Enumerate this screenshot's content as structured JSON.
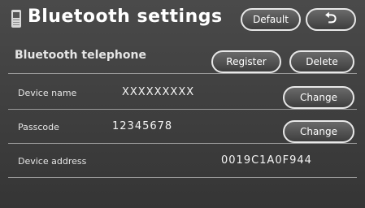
{
  "header": {
    "title": "Bluetooth settings",
    "default_label": "Default",
    "back_label": "⮌"
  },
  "bluetooth_telephone": {
    "label": "Bluetooth telephone",
    "register_label": "Register",
    "delete_label": "Delete"
  },
  "device_name": {
    "label": "Device name",
    "value": "XXXXXXXXX",
    "change_label": "Change"
  },
  "passcode": {
    "label": "Passcode",
    "value": "12345678",
    "change_label": "Change"
  },
  "device_address": {
    "label": "Device address",
    "value": "0019C1A0F944"
  }
}
